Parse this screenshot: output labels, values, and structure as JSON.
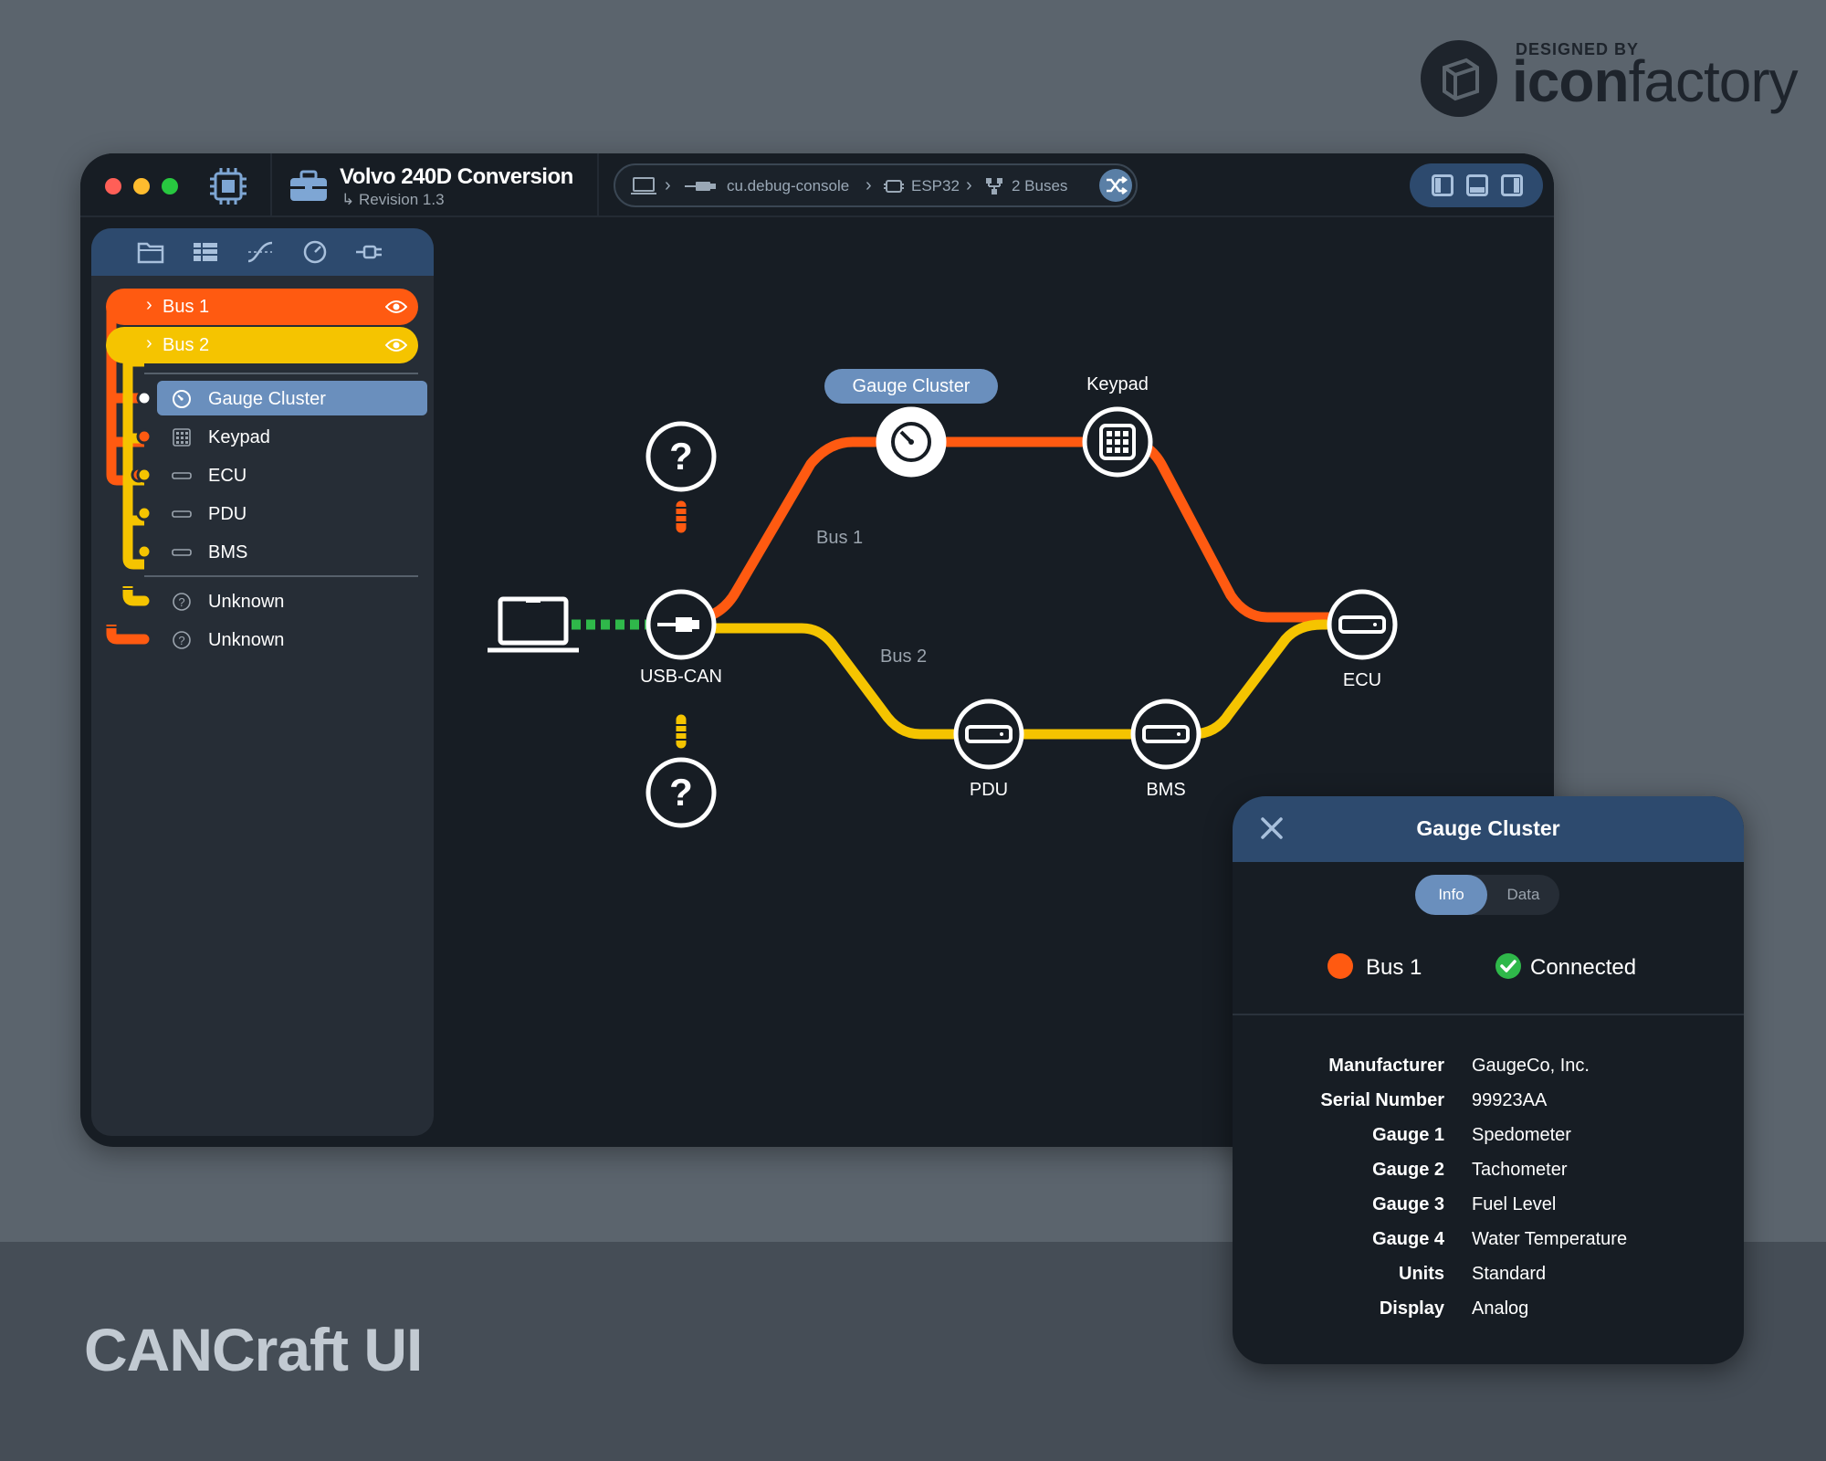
{
  "brand": {
    "small": "DESIGNED BY",
    "name_bold": "icon",
    "name_rest": "factory"
  },
  "product_title": "CANCraft UI",
  "titlebar": {
    "project_name": "Volvo 240D Conversion",
    "project_revision": "Revision 1.3",
    "breadcrumbs": [
      "cu.debug-console",
      "ESP32",
      "2 Buses"
    ]
  },
  "sidebar": {
    "tabs": [
      "folder-icon",
      "table-icon",
      "curve-icon",
      "gauge-icon",
      "plug-icon"
    ],
    "buses": [
      {
        "label": "Bus 1",
        "color": "#ff5a11"
      },
      {
        "label": "Bus 2",
        "color": "#f5c400"
      }
    ],
    "nodes": [
      {
        "label": "Gauge Cluster",
        "icon": "gauge-icon",
        "selected": true
      },
      {
        "label": "Keypad",
        "icon": "keypad-icon"
      },
      {
        "label": "ECU",
        "icon": "module-icon"
      },
      {
        "label": "PDU",
        "icon": "module-icon"
      },
      {
        "label": "BMS",
        "icon": "module-icon"
      }
    ],
    "unknown": [
      {
        "label": "Unknown",
        "icon": "question-icon"
      },
      {
        "label": "Unknown",
        "icon": "question-icon"
      }
    ]
  },
  "graph": {
    "selected_label": "Gauge Cluster",
    "keypad_label": "Keypad",
    "usb_label": "USB-CAN",
    "ecu_label": "ECU",
    "pdu_label": "PDU",
    "bms_label": "BMS",
    "bus1_label": "Bus 1",
    "bus2_label": "Bus 2",
    "unknown_mark": "?",
    "colors": {
      "bus1": "#ff5a11",
      "bus2": "#f5c400",
      "usb_link": "#2fb84a"
    }
  },
  "inspector": {
    "title": "Gauge Cluster",
    "tabs": {
      "info": "Info",
      "data": "Data"
    },
    "active_tab": "Info",
    "bus": "Bus 1",
    "status": "Connected",
    "props": [
      {
        "k": "Manufacturer",
        "v": "GaugeCo, Inc."
      },
      {
        "k": "Serial Number",
        "v": "99923AA"
      },
      {
        "k": "Gauge 1",
        "v": "Spedometer"
      },
      {
        "k": "Gauge 2",
        "v": "Tachometer"
      },
      {
        "k": "Gauge 3",
        "v": "Fuel Level"
      },
      {
        "k": "Gauge 4",
        "v": "Water Temperature"
      },
      {
        "k": "Units",
        "v": "Standard"
      },
      {
        "k": "Display",
        "v": "Analog"
      }
    ]
  }
}
